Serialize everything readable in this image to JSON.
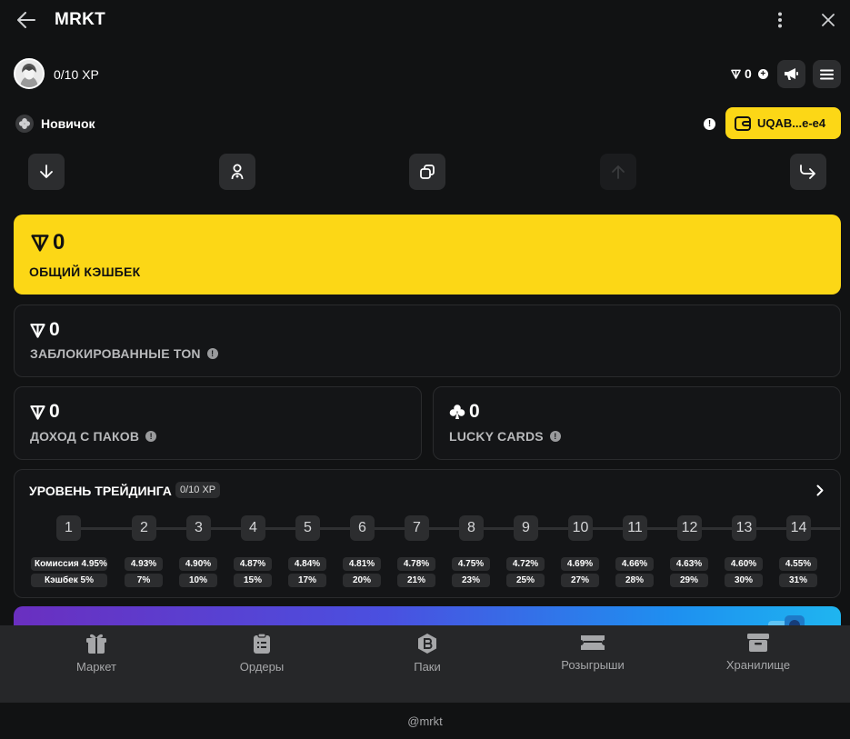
{
  "header": {
    "title": "MRKT"
  },
  "profile": {
    "xp_text": "0/10 XP",
    "balance": "0",
    "plus": "+"
  },
  "rank": {
    "label": "Новичок",
    "warn": "!"
  },
  "wallet": {
    "label": "UQAB...e-e4"
  },
  "summary": {
    "total_cashback": {
      "value": "0",
      "label": "ОБЩИЙ КЭШБЕК"
    },
    "locked_ton": {
      "value": "0",
      "label": "ЗАБЛОКИРОВАННЫЕ TON",
      "info": "!"
    },
    "pack_income": {
      "value": "0",
      "label": "ДОХОД С ПАКОВ",
      "info": "!"
    },
    "lucky_cards": {
      "value": "0",
      "label": "LUCKY CARDS",
      "info": "!"
    }
  },
  "trading_level": {
    "title": "УРОВЕНЬ ТРЕЙДИНГА",
    "badge": "0/10 XP",
    "levels": [
      {
        "n": "1",
        "commission": "Комиссия 4.95%",
        "cashback": "Кэшбек 5%"
      },
      {
        "n": "2",
        "commission": "4.93%",
        "cashback": "7%"
      },
      {
        "n": "3",
        "commission": "4.90%",
        "cashback": "10%"
      },
      {
        "n": "4",
        "commission": "4.87%",
        "cashback": "15%"
      },
      {
        "n": "5",
        "commission": "4.84%",
        "cashback": "17%"
      },
      {
        "n": "6",
        "commission": "4.81%",
        "cashback": "20%"
      },
      {
        "n": "7",
        "commission": "4.78%",
        "cashback": "21%"
      },
      {
        "n": "8",
        "commission": "4.75%",
        "cashback": "23%"
      },
      {
        "n": "9",
        "commission": "4.72%",
        "cashback": "25%"
      },
      {
        "n": "10",
        "commission": "4.69%",
        "cashback": "27%"
      },
      {
        "n": "11",
        "commission": "4.66%",
        "cashback": "28%"
      },
      {
        "n": "12",
        "commission": "4.63%",
        "cashback": "29%"
      },
      {
        "n": "13",
        "commission": "4.60%",
        "cashback": "30%"
      },
      {
        "n": "14",
        "commission": "4.55%",
        "cashback": "31%"
      }
    ]
  },
  "nav": {
    "market": "Маркет",
    "orders": "Ордеры",
    "packs": "Паки",
    "giveaways": "Розыгрыши",
    "storage": "Хранилище"
  },
  "footer": {
    "handle": "@mrkt"
  }
}
